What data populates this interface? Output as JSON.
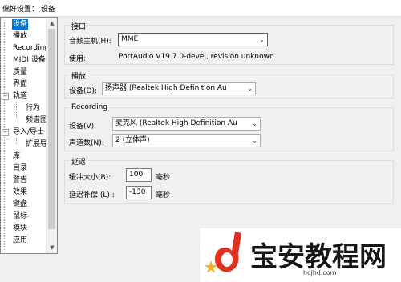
{
  "window": {
    "title": "偏好设置： 设备"
  },
  "sidebar": {
    "items": [
      {
        "label": "设备",
        "selected": true
      },
      {
        "label": "播放"
      },
      {
        "label": "Recording"
      },
      {
        "label": "MIDI 设备"
      },
      {
        "label": "质量"
      },
      {
        "label": "界面"
      },
      {
        "label": "轨道",
        "expander": "−"
      },
      {
        "label": "行为"
      },
      {
        "label": "频谱图"
      },
      {
        "label": "导入/导出",
        "expander": "−"
      },
      {
        "label": "扩展导"
      },
      {
        "label": "库"
      },
      {
        "label": "目录"
      },
      {
        "label": "警告"
      },
      {
        "label": "效果"
      },
      {
        "label": "键盘"
      },
      {
        "label": "鼠标"
      },
      {
        "label": "模块"
      },
      {
        "label": "应用"
      }
    ]
  },
  "interface_group": {
    "title": "接口",
    "host_label": "音频主机(H):",
    "host_value": "MME",
    "using_label": "使用:",
    "using_value": "PortAudio V19.7.0-devel, revision unknown"
  },
  "playback_group": {
    "title": "播放",
    "device_label": "设备(D):",
    "device_value": "扬声器 (Realtek High Definition Au"
  },
  "recording_group": {
    "title": "Recording",
    "device_label": "设备(V):",
    "device_value": "麦克风 (Realtek High Definition Au",
    "channels_label": "声道数(N):",
    "channels_value": "2 (立体声)"
  },
  "latency_group": {
    "title": "延迟",
    "buffer_label": "缓冲大小(B):",
    "buffer_value": "100",
    "buffer_unit": "毫秒",
    "comp_label": "延迟补偿 (L) :",
    "comp_value": "-130",
    "comp_unit": "毫秒"
  },
  "watermark": {
    "text": "宝安教程网",
    "url": "hcjhd.com",
    "accent": "#e0301e"
  }
}
